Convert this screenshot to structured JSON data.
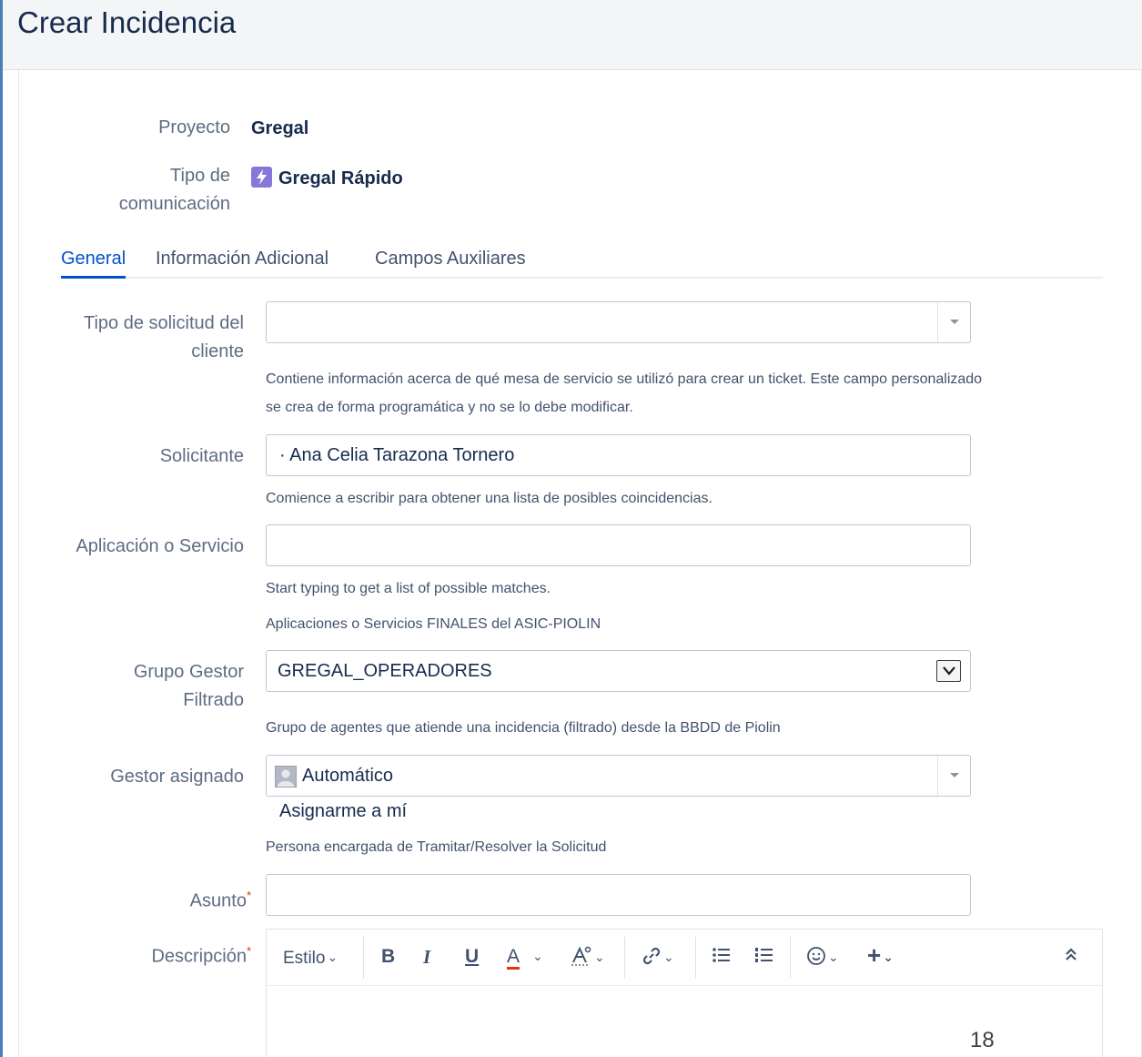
{
  "header": {
    "title": "Crear Incidencia"
  },
  "project": {
    "label": "Proyecto",
    "value": "Gregal"
  },
  "comm_type": {
    "label_line1": "Tipo de",
    "label_line2": "comunicación",
    "value": "Gregal Rápido",
    "icon": "lightning-icon",
    "icon_color": "#8777d9"
  },
  "tabs": [
    {
      "label": "General",
      "active": true
    },
    {
      "label": "Información Adicional",
      "active": false
    },
    {
      "label": "Campos Auxiliares",
      "active": false
    }
  ],
  "fields": {
    "request_type": {
      "label_line1": "Tipo de solicitud del",
      "label_line2": "cliente",
      "value": "",
      "help_line1": "Contiene información acerca de qué mesa de servicio se utilizó para crear un ticket. Este campo personalizado",
      "help_line2": "se crea de forma programática y no se lo debe modificar."
    },
    "requester": {
      "label": "Solicitante",
      "value": "·  Ana Celia Tarazona Tornero",
      "help": "Comience a escribir para obtener una lista de posibles coincidencias."
    },
    "application": {
      "label": "Aplicación o Servicio",
      "value": "",
      "help_line1": "Start typing to get a list of possible matches.",
      "help_line2": "Aplicaciones o Servicios FINALES del ASIC-PIOLIN"
    },
    "group": {
      "label_line1": "Grupo Gestor",
      "label_line2": "Filtrado",
      "value": "GREGAL_OPERADORES",
      "help": "Grupo de agentes que atiende una incidencia (filtrado) desde la BBDD de Piolin"
    },
    "assignee": {
      "label": "Gestor asignado",
      "value": "Automático",
      "assign_me": "Asignarme a mí",
      "help": "Persona encargada de Tramitar/Resolver la Solicitud"
    },
    "summary": {
      "label": "Asunto",
      "required_mark": "*",
      "value": ""
    },
    "description": {
      "label": "Descripción",
      "required_mark": "*",
      "toolbar": {
        "style_label": "Estilo",
        "bold": "B",
        "italic": "I",
        "underline": "U",
        "text_color": "A",
        "accent_color": "#de350b"
      }
    }
  },
  "footer": {
    "page_number": "18"
  },
  "colors": {
    "link_blue": "#0052cc",
    "frame_blue": "#4a7fb8"
  }
}
